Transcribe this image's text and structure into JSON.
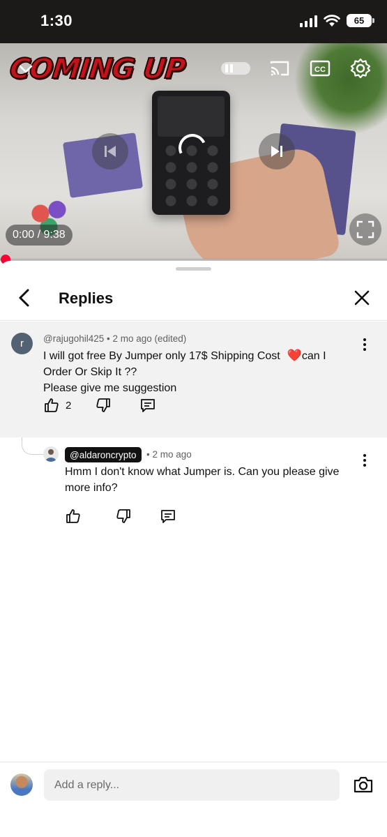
{
  "status_bar": {
    "time": "1:30",
    "battery": "65"
  },
  "video": {
    "overlay_title": "COMING UP",
    "time_display": "0:00 / 9:38",
    "progress": 0
  },
  "replies_panel": {
    "title": "Replies",
    "parent_comment": {
      "avatar_initial": "r",
      "author": "@rajugohil425",
      "meta_suffix": " • 2 mo ago (edited)",
      "line1": "I will got free By Jumper only 17$ Shipping Cost",
      "heart": "❤️",
      "line1_end": "can I",
      "line2": "Order Or Skip It ??",
      "line3": "Please give me  suggestion",
      "like_count": "2"
    },
    "reply": {
      "author": "@aldaroncrypto",
      "time": "• 2 mo ago",
      "text": "Hmm I don't know what Jumper is. Can you please give more info?"
    }
  },
  "composer": {
    "placeholder": "Add a reply..."
  }
}
